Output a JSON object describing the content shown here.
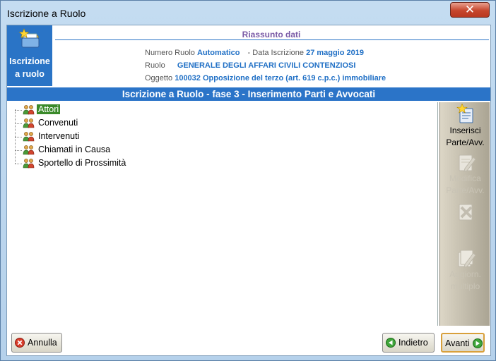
{
  "window": {
    "title": "Iscrizione a Ruolo",
    "close_glyph": "✕"
  },
  "summary": {
    "side_label_line1": "Iscrizione",
    "side_label_line2": "a ruolo",
    "side_icon": "folder-star-icon",
    "heading": "Riassunto dati",
    "numero_ruolo_label": "Numero Ruolo",
    "numero_ruolo_value": "Automatico",
    "data_iscrizione_label": "- Data Iscrizione",
    "data_iscrizione_value": "27 maggio 2019",
    "ruolo_label": "Ruolo",
    "ruolo_value": "GENERALE DEGLI AFFARI CIVILI CONTENZIOSI",
    "oggetto_label": "Oggetto",
    "oggetto_value": "100032 Opposizione del terzo (art. 619 c.p.c.) immobiliare"
  },
  "phase_title": "Iscrizione a Ruolo - fase 3 - Inserimento Parti e Avvocati",
  "tree": {
    "items": [
      {
        "label": "Attori",
        "selected": true
      },
      {
        "label": "Convenuti",
        "selected": false
      },
      {
        "label": "Intervenuti",
        "selected": false
      },
      {
        "label": "Chiamati in Causa",
        "selected": false
      },
      {
        "label": "Sportello di Prossimità",
        "selected": false
      }
    ]
  },
  "actions": {
    "inserisci_line1": "Inserisci",
    "inserisci_line2": "Parte/Avv.",
    "modifica_line1": "Modifica",
    "modifica_line2": "Parte/Avv.",
    "aggiorna_line1": "Aggiorn.",
    "aggiorna_line2": "multiplo"
  },
  "footer": {
    "annulla_label": "Annulla",
    "indietro_label": "Indietro",
    "avanti_label": "Avanti"
  },
  "colors": {
    "accent_blue": "#2b74c8",
    "selected_green": "#3a8a2a",
    "value_blue": "#1f6fc5",
    "heading_purple": "#7a5aa6"
  }
}
